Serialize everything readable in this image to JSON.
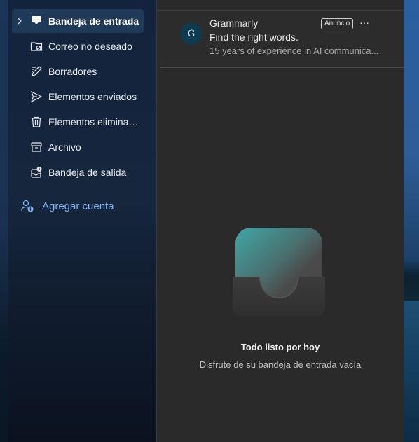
{
  "nav": {
    "items": [
      {
        "label": "Bandeja de entrada",
        "icon": "inbox-icon",
        "active": true
      },
      {
        "label": "Correo no deseado",
        "icon": "junk-folder-icon"
      },
      {
        "label": "Borradores",
        "icon": "pencil-drafts-icon"
      },
      {
        "label": "Elementos enviados",
        "icon": "send-icon"
      },
      {
        "label": "Elementos eliminad...",
        "icon": "trash-icon"
      },
      {
        "label": "Archivo",
        "icon": "archive-icon"
      },
      {
        "label": "Bandeja de salida",
        "icon": "outbox-icon"
      }
    ],
    "add_account": "Agregar cuenta"
  },
  "ad": {
    "avatar_letter": "G",
    "sender": "Grammarly",
    "subject": "Find the right words.",
    "preview": "15 years of experience in AI communica...",
    "badge": "Anuncio",
    "more": "···"
  },
  "empty": {
    "title": "Todo listo por hoy",
    "subtitle": "Disfrute de su bandeja de entrada vacía"
  },
  "colors": {
    "accent": "#7fb4f5",
    "active_bg": "#1f3a58",
    "pane_bg": "#2a2a2a"
  }
}
